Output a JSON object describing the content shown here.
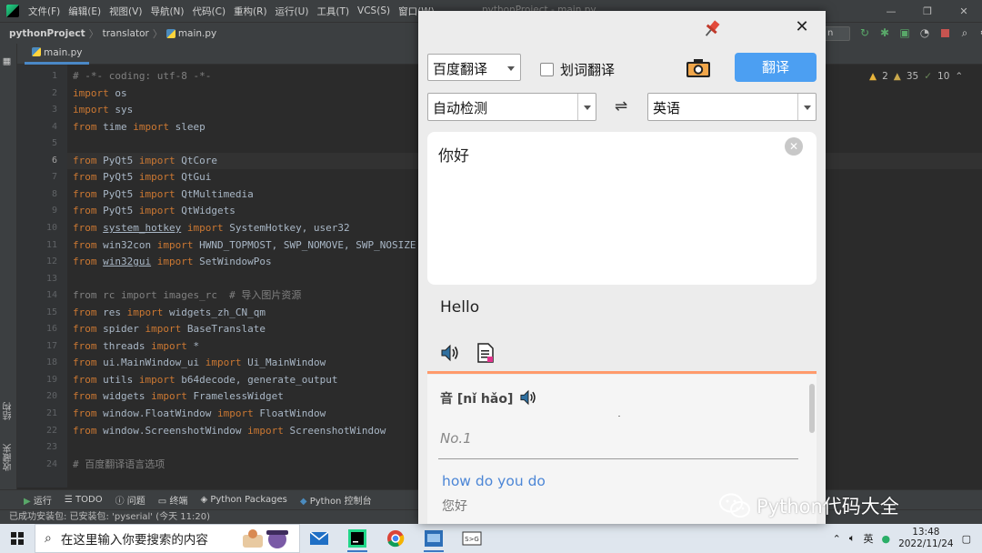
{
  "ide": {
    "menu": [
      "文件(F)",
      "编辑(E)",
      "视图(V)",
      "导航(N)",
      "代码(C)",
      "重构(R)",
      "运行(U)",
      "工具(T)",
      "VCS(S)",
      "窗口(W)"
    ],
    "window_title": "pythonProject - main.py",
    "breadcrumb": {
      "project": "pythonProject",
      "folder": "translator",
      "file": "main.py"
    },
    "run_config": "n",
    "editor_tab": "main.py",
    "inspections": {
      "warnings": "2",
      "weak_warnings": "35",
      "checks": "10"
    },
    "left_tabs": [
      "结构",
      "收藏夹"
    ],
    "line_numbers": [
      "1",
      "2",
      "3",
      "4",
      "5",
      "6",
      "7",
      "8",
      "9",
      "10",
      "11",
      "12",
      "13",
      "14",
      "15",
      "16",
      "17",
      "18",
      "19",
      "20",
      "21",
      "22",
      "23",
      "24"
    ],
    "current_line": "6",
    "code": {
      "l1": "# -*- coding: utf-8 -*-",
      "l2": "os",
      "l3": "sys",
      "l4a": "time",
      "l4b": "sleep",
      "l6a": "PyQt5",
      "l6b": "QtCore",
      "l7a": "PyQt5",
      "l7b": "QtGui",
      "l8a": "PyQt5",
      "l8b": "QtMultimedia",
      "l9a": "PyQt5",
      "l9b": "QtWidgets",
      "l10a": "system_hotkey",
      "l10b": "SystemHotkey, user32",
      "l11a": "win32con",
      "l11b": "HWND_TOPMOST, SWP_NOMOVE, SWP_NOSIZE",
      "l12a": "win32gui",
      "l12b": "SetWindowPos",
      "l14": "from rc import images_rc  # 导入图片资源",
      "l15a": "res",
      "l15b": "widgets_zh_CN_qm",
      "l16a": "spider",
      "l16b": "BaseTranslate",
      "l17a": "threads",
      "l17b": "*",
      "l18a": "ui.MainWindow_ui",
      "l18b": "Ui_MainWindow",
      "l19a": "utils",
      "l19b": "b64decode, generate_output",
      "l20a": "widgets",
      "l20b": "FramelessWidget",
      "l21a": "window.FloatWindow",
      "l21b": "FloatWindow",
      "l22a": "window.ScreenshotWindow",
      "l22b": "ScreenshotWindow",
      "l24": "# 百度翻译语言选项",
      "kw_from": "from",
      "kw_import": "import"
    },
    "bottom_tools": [
      "运行",
      "TODO",
      "问题",
      "终端",
      "Python Packages",
      "Python 控制台"
    ],
    "status": "已成功安装包: 已安装包: 'pyserial' (今天 11:20)"
  },
  "taskbar": {
    "search_placeholder": "在这里输入你要搜索的内容",
    "time": "13:48",
    "date": "2022/11/24"
  },
  "translator": {
    "engine": "百度翻译",
    "word_select_label": "划词翻译",
    "translate_label": "翻译",
    "source_lang": "自动检测",
    "swap_symbol": "⇌",
    "target_lang": "英语",
    "source_text": "你好",
    "result_text": "Hello",
    "pinyin": "音 [nǐ hǎo]",
    "no_label": "No.1",
    "phrase": "how do you do",
    "phrase_meaning": "您好"
  },
  "watermark": "Python代码大全",
  "colors": {
    "accent": "#4c9ff2",
    "divider": "#ff9a6b",
    "keyword": "#cc7832",
    "link": "#4c86d6"
  }
}
